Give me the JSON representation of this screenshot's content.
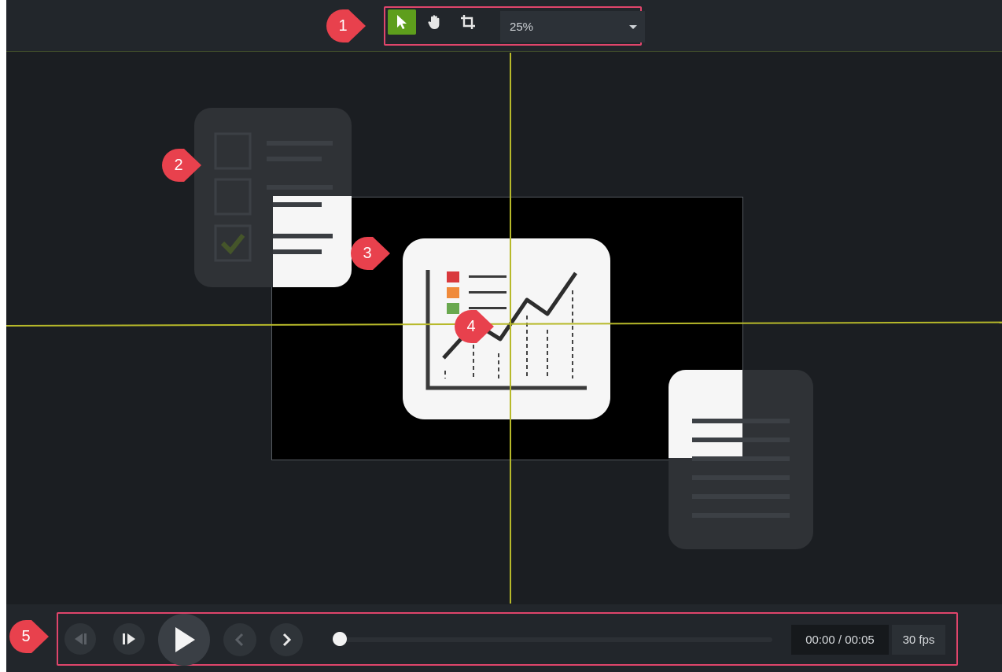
{
  "toolbar": {
    "tools": [
      {
        "name": "select-tool",
        "icon": "arrow-pointer-icon",
        "active": true
      },
      {
        "name": "pan-tool",
        "icon": "hand-icon",
        "active": false
      },
      {
        "name": "crop-tool",
        "icon": "crop-icon",
        "active": false
      }
    ],
    "zoom_value": "25%",
    "accent_color": "#5e9e1c"
  },
  "callouts": [
    "1",
    "2",
    "3",
    "4",
    "5"
  ],
  "callout_color": "#e8414d",
  "highlight_color": "#e0456b",
  "guide_color": "#b7b92a",
  "playback": {
    "buttons": [
      {
        "name": "step-back-button",
        "icon": "step-back-icon"
      },
      {
        "name": "step-forward-button",
        "icon": "step-forward-icon"
      },
      {
        "name": "play-button",
        "icon": "play-icon"
      },
      {
        "name": "previous-button",
        "icon": "chevron-left-icon"
      },
      {
        "name": "next-button",
        "icon": "chevron-right-icon"
      }
    ],
    "progress": 0,
    "time": "00:00 / 00:05",
    "fps": "30 fps"
  }
}
